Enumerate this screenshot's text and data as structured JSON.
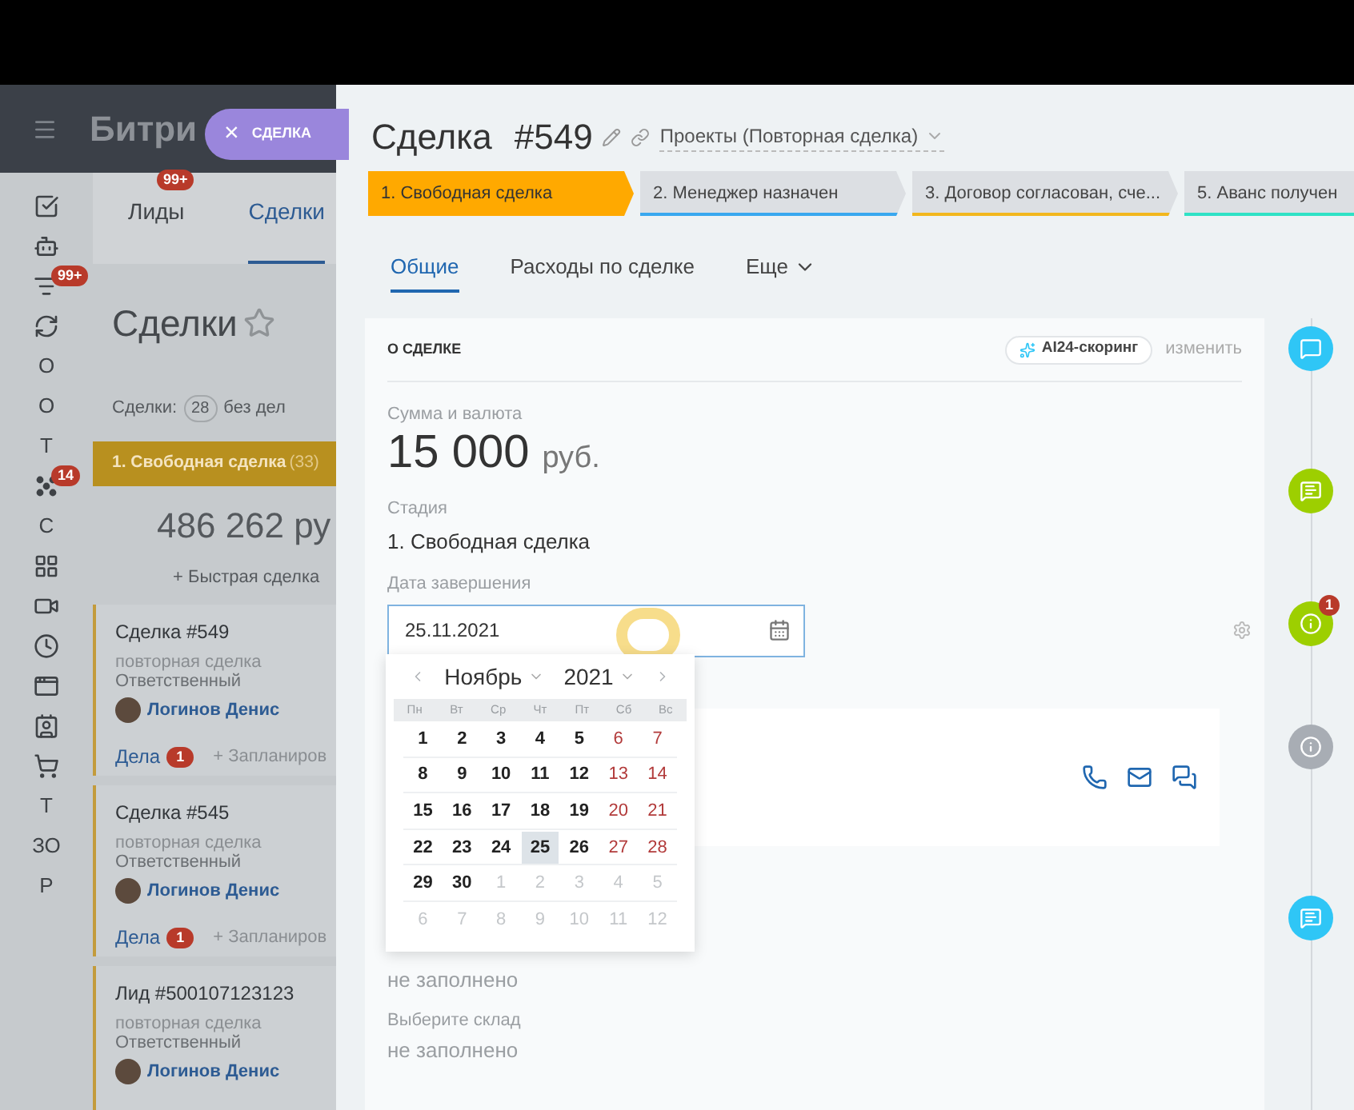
{
  "left_app": {
    "logo": "Битри",
    "tabs": [
      {
        "label": "Лиды",
        "badge": "99+",
        "selected": false
      },
      {
        "label": "Сделки",
        "selected": true
      }
    ],
    "sidebar": [
      {
        "kind": "icon"
      },
      {
        "kind": "icon"
      },
      {
        "kind": "icon",
        "badge": "99+"
      },
      {
        "kind": "icon"
      },
      {
        "kind": "letter",
        "label": "О"
      },
      {
        "kind": "letter",
        "label": "О"
      },
      {
        "kind": "letter",
        "label": "Т"
      },
      {
        "kind": "icon",
        "badge": "14"
      },
      {
        "kind": "letter",
        "label": "С"
      },
      {
        "kind": "icon"
      },
      {
        "kind": "icon"
      },
      {
        "kind": "icon"
      },
      {
        "kind": "icon"
      },
      {
        "kind": "icon"
      },
      {
        "kind": "icon"
      },
      {
        "kind": "letter",
        "label": "Т"
      },
      {
        "kind": "letter",
        "label": "ЗО"
      },
      {
        "kind": "letter",
        "label": "Р"
      }
    ],
    "heading": "Сделки",
    "counter_label": "Сделки:",
    "counter": "28",
    "counter_suffix": "без дел",
    "column": {
      "title": "1. Свободная сделка",
      "count": "(33)",
      "sum": "486 262 ру",
      "quick_add": "+ Быстрая сделка"
    },
    "cards": [
      {
        "title": "Сделка #549",
        "subtitle": "повторная сделка",
        "role": "Ответственный",
        "person": "Логинов Денис",
        "tasks": "Дела",
        "tasks_badge": "1",
        "plan": "+ Запланиров"
      },
      {
        "title": "Сделка #545",
        "subtitle": "повторная сделка",
        "role": "Ответственный",
        "person": "Логинов Денис",
        "tasks": "Дела",
        "tasks_badge": "1",
        "plan": "+ Запланиров"
      },
      {
        "title": "Лид #500107123123",
        "subtitle": "повторная сделка",
        "role": "Ответственный",
        "person": "Логинов Денис"
      }
    ]
  },
  "close_tab": {
    "glyph": "×",
    "label": "СДЕЛКА"
  },
  "deal": {
    "title": "Сделка",
    "number": "#549",
    "category": "Проекты (Повторная сделка)",
    "stages": [
      {
        "label": "1. Свободная сделка",
        "selected": true,
        "color": "#ffa900"
      },
      {
        "label": "2. Менеджер назначен",
        "selected": false,
        "color": "#39a8ef"
      },
      {
        "label": "3. Договор согласован, сче...",
        "selected": false,
        "color": "#f2b71d"
      },
      {
        "label": "5. Аванс получен",
        "selected": false,
        "color": "#2fe2c5"
      }
    ],
    "tabs": [
      {
        "label": "Общие",
        "selected": true
      },
      {
        "label": "Расходы по сделке",
        "selected": false
      },
      {
        "label": "Еще",
        "selected": false
      }
    ],
    "section": {
      "title": "О СДЕЛКЕ",
      "scoring": "AI24-скоринг",
      "edit": "изменить",
      "amount_label": "Сумма и валюта",
      "amount": "15 000",
      "currency": "руб.",
      "stage_label": "Стадия",
      "stage": "1. Свободная сделка",
      "date_label": "Дата завершения",
      "date_value": "25.11.2021",
      "fields_below": [
        {
          "value": "не заполнено"
        },
        {
          "label": "Выберите склад",
          "value": "не заполнено"
        }
      ]
    },
    "calendar": {
      "month": "Ноябрь",
      "year": "2021",
      "weekdays": [
        "Пн",
        "Вт",
        "Ср",
        "Чт",
        "Пт",
        "Сб",
        "Вс"
      ],
      "weeks": [
        [
          {
            "d": "1",
            "other": false,
            "weekend": false,
            "selected": false
          },
          {
            "d": "2",
            "other": false,
            "weekend": false,
            "selected": false
          },
          {
            "d": "3",
            "other": false,
            "weekend": false,
            "selected": false
          },
          {
            "d": "4",
            "other": false,
            "weekend": false,
            "selected": false
          },
          {
            "d": "5",
            "other": false,
            "weekend": false,
            "selected": false
          },
          {
            "d": "6",
            "other": false,
            "weekend": true,
            "selected": false
          },
          {
            "d": "7",
            "other": false,
            "weekend": true,
            "selected": false
          }
        ],
        [
          {
            "d": "8",
            "other": false,
            "weekend": false,
            "selected": false
          },
          {
            "d": "9",
            "other": false,
            "weekend": false,
            "selected": false
          },
          {
            "d": "10",
            "other": false,
            "weekend": false,
            "selected": false
          },
          {
            "d": "11",
            "other": false,
            "weekend": false,
            "selected": false
          },
          {
            "d": "12",
            "other": false,
            "weekend": false,
            "selected": false
          },
          {
            "d": "13",
            "other": false,
            "weekend": true,
            "selected": false
          },
          {
            "d": "14",
            "other": false,
            "weekend": true,
            "selected": false
          }
        ],
        [
          {
            "d": "15",
            "other": false,
            "weekend": false,
            "selected": false
          },
          {
            "d": "16",
            "other": false,
            "weekend": false,
            "selected": false
          },
          {
            "d": "17",
            "other": false,
            "weekend": false,
            "selected": false
          },
          {
            "d": "18",
            "other": false,
            "weekend": false,
            "selected": false
          },
          {
            "d": "19",
            "other": false,
            "weekend": false,
            "selected": false
          },
          {
            "d": "20",
            "other": false,
            "weekend": true,
            "selected": false
          },
          {
            "d": "21",
            "other": false,
            "weekend": true,
            "selected": false
          }
        ],
        [
          {
            "d": "22",
            "other": false,
            "weekend": false,
            "selected": false
          },
          {
            "d": "23",
            "other": false,
            "weekend": false,
            "selected": false
          },
          {
            "d": "24",
            "other": false,
            "weekend": false,
            "selected": false
          },
          {
            "d": "25",
            "other": false,
            "weekend": false,
            "selected": true
          },
          {
            "d": "26",
            "other": false,
            "weekend": false,
            "selected": false
          },
          {
            "d": "27",
            "other": false,
            "weekend": true,
            "selected": false
          },
          {
            "d": "28",
            "other": false,
            "weekend": true,
            "selected": false
          }
        ],
        [
          {
            "d": "29",
            "other": false,
            "weekend": false,
            "selected": false
          },
          {
            "d": "30",
            "other": false,
            "weekend": false,
            "selected": false
          },
          {
            "d": "1",
            "other": true,
            "selected": false
          },
          {
            "d": "2",
            "other": true,
            "selected": false
          },
          {
            "d": "3",
            "other": true,
            "selected": false
          },
          {
            "d": "4",
            "other": true,
            "selected": false
          },
          {
            "d": "5",
            "other": true,
            "selected": false
          }
        ],
        [
          {
            "d": "6",
            "other": true,
            "selected": false
          },
          {
            "d": "7",
            "other": true,
            "selected": false
          },
          {
            "d": "8",
            "other": true,
            "selected": false
          },
          {
            "d": "9",
            "other": true,
            "selected": false
          },
          {
            "d": "10",
            "other": true,
            "selected": false
          },
          {
            "d": "11",
            "other": true,
            "selected": false
          },
          {
            "d": "12",
            "other": true,
            "selected": false
          }
        ]
      ]
    },
    "timeline": [
      {
        "kind": "chat",
        "color": "#2fc6f6"
      },
      {
        "kind": "comment",
        "color": "#9dcf00"
      },
      {
        "kind": "info",
        "color": "#9dcf00",
        "badge": "1"
      },
      {
        "kind": "info",
        "color": "#a8adb4"
      },
      {
        "kind": "message",
        "color": "#2fc6f6"
      }
    ]
  }
}
